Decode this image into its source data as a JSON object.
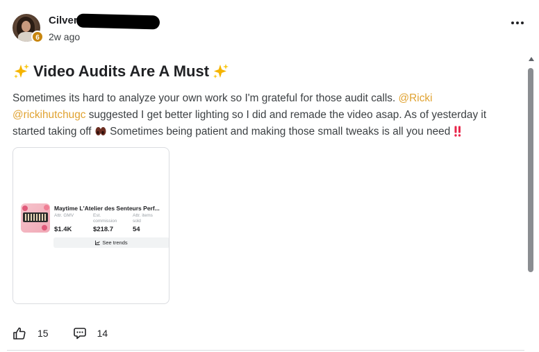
{
  "post": {
    "author": {
      "name_visible": "Cilver",
      "level": "6",
      "timestamp": "2w ago"
    },
    "menu_icon": "more-horizontal-icon",
    "title": "Video Audits Are A Must",
    "title_icon": "sparkles-emoji",
    "body": {
      "part1": "Sometimes its hard to analyze your own work so I'm grateful for those audit calls. ",
      "mention1": "@Ricki",
      "space": " ",
      "mention2": "@rickihutchugc",
      "part2": " suggested I get better lighting so I did and remade the video asap. As of yesterday it started taking off ",
      "part3": " Sometimes being patient and making those small tweaks is all you need ",
      "emoji1": "eyes-emoji",
      "emoji2": "double-exclamation-emoji"
    },
    "attachment": {
      "product_name": "Maytime L'Atelier des Senteurs Perf...",
      "metrics": [
        {
          "label": "Attr. GMV",
          "value": "$1.4K"
        },
        {
          "label": "Est. commission",
          "value": "$218.7"
        },
        {
          "label": "Attr. items sold",
          "value": "54"
        }
      ],
      "trends_label": "See trends"
    },
    "actions": {
      "likes": "15",
      "comments": "14",
      "like_icon": "thumbs-up-icon",
      "comment_icon": "comment-icon"
    },
    "colors": {
      "mention": "#e0a230",
      "level_badge": "#c8860f",
      "text": "#3c4043"
    }
  }
}
